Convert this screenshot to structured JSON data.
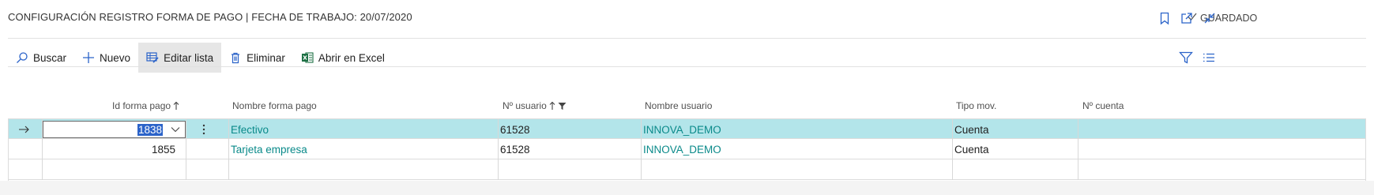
{
  "header": {
    "title": "CONFIGURACIÓN REGISTRO FORMA DE PAGO | FECHA DE TRABAJO: 20/07/2020",
    "saved_label": "GUARDADO"
  },
  "toolbar": {
    "search": "Buscar",
    "new": "Nuevo",
    "edit_list": "Editar lista",
    "delete": "Eliminar",
    "open_excel": "Abrir en Excel"
  },
  "columns": {
    "payment_id": "Id forma pago",
    "payment_name": "Nombre forma pago",
    "user_no": "Nº usuario",
    "user_name": "Nombre usuario",
    "mov_type": "Tipo mov.",
    "account_no": "Nº cuenta"
  },
  "rows": [
    {
      "payment_id": "1838",
      "payment_name": "Efectivo",
      "user_no": "61528",
      "user_name": "INNOVA_DEMO",
      "mov_type": "Cuenta",
      "account_no": ""
    },
    {
      "payment_id": "1855",
      "payment_name": "Tarjeta empresa",
      "user_no": "61528",
      "user_name": "INNOVA_DEMO",
      "mov_type": "Cuenta",
      "account_no": ""
    }
  ],
  "colors": {
    "selected_row": "#b3e5ea",
    "link": "#0a8a8a",
    "accent": "#2b63c9"
  },
  "icons": [
    "checkmark-icon",
    "bookmark-icon",
    "open-new-window-icon",
    "collapse-icon",
    "search-icon",
    "plus-icon",
    "edit-list-icon",
    "trash-icon",
    "excel-icon",
    "filter-icon",
    "list-view-icon",
    "arrow-right-icon",
    "sort-up-icon",
    "funnel-icon",
    "chevron-down-icon",
    "more-vertical-icon"
  ]
}
